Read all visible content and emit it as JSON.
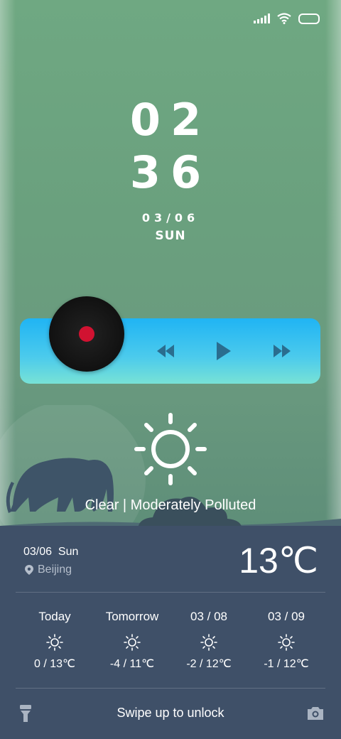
{
  "clock": {
    "hours": "02",
    "minutes": "36",
    "date": "03/06",
    "weekday": "SUN"
  },
  "player": {
    "controls": [
      "rewind-icon",
      "play-icon",
      "fast-forward-icon"
    ],
    "accent": "#d11231"
  },
  "weather": {
    "condition": "Clear | Moderately Polluted",
    "date": "03/06  Sun",
    "location": "Beijing",
    "temperature": "13℃",
    "forecast": [
      {
        "label": "Today",
        "range": "0 / 13℃"
      },
      {
        "label": "Tomorrow",
        "range": "-4 / 11℃"
      },
      {
        "label": "03 / 08",
        "range": "-2 / 12℃"
      },
      {
        "label": "03 / 09",
        "range": "-1 / 12℃"
      }
    ]
  },
  "footer": {
    "unlock_text": "Swipe up to unlock"
  }
}
